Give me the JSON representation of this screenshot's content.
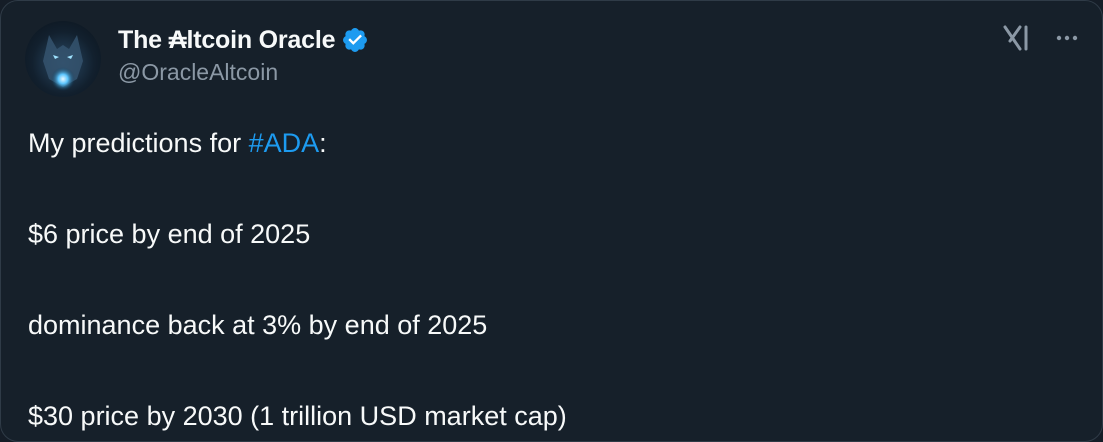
{
  "author": {
    "display_name": "The ₳ltcoin Oracle",
    "handle": "@OracleAltcoin",
    "verified": true
  },
  "icons": {
    "verified": "verified-badge-icon",
    "platform": "x-logo-icon",
    "more": "more-options-icon"
  },
  "colors": {
    "background": "#16202a",
    "text": "#f7f9f9",
    "secondary_text": "#8b98a5",
    "link": "#1d9bf0",
    "verified": "#1d9bf0"
  },
  "post": {
    "line1_prefix": "My predictions for ",
    "hashtag": "#ADA",
    "line1_suffix": ":",
    "line2": "$6 price by end of 2025",
    "line3": "dominance back at 3% by end of 2025",
    "line4": "$30 price by 2030 (1 trillion USD market cap)"
  }
}
